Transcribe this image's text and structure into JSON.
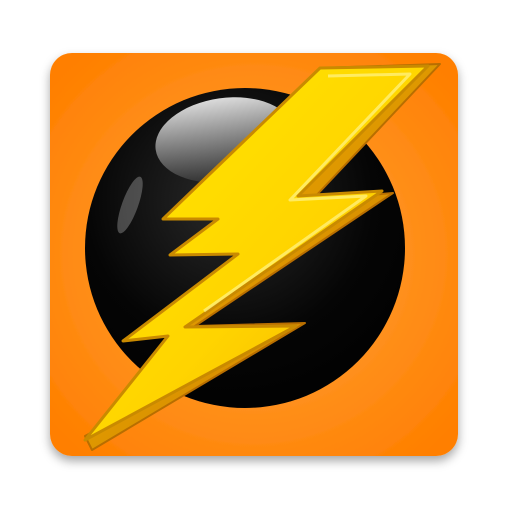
{
  "icon": {
    "name": "lightning-bolt-app-icon",
    "colors": {
      "tile": "#ff7f00",
      "tile_glow": "#ffa640",
      "orb": "#000000",
      "orb_highlight": "#ffffff",
      "bolt_light": "#ffea00",
      "bolt_dark": "#f2a900",
      "bolt_outline": "#b86e00"
    }
  }
}
